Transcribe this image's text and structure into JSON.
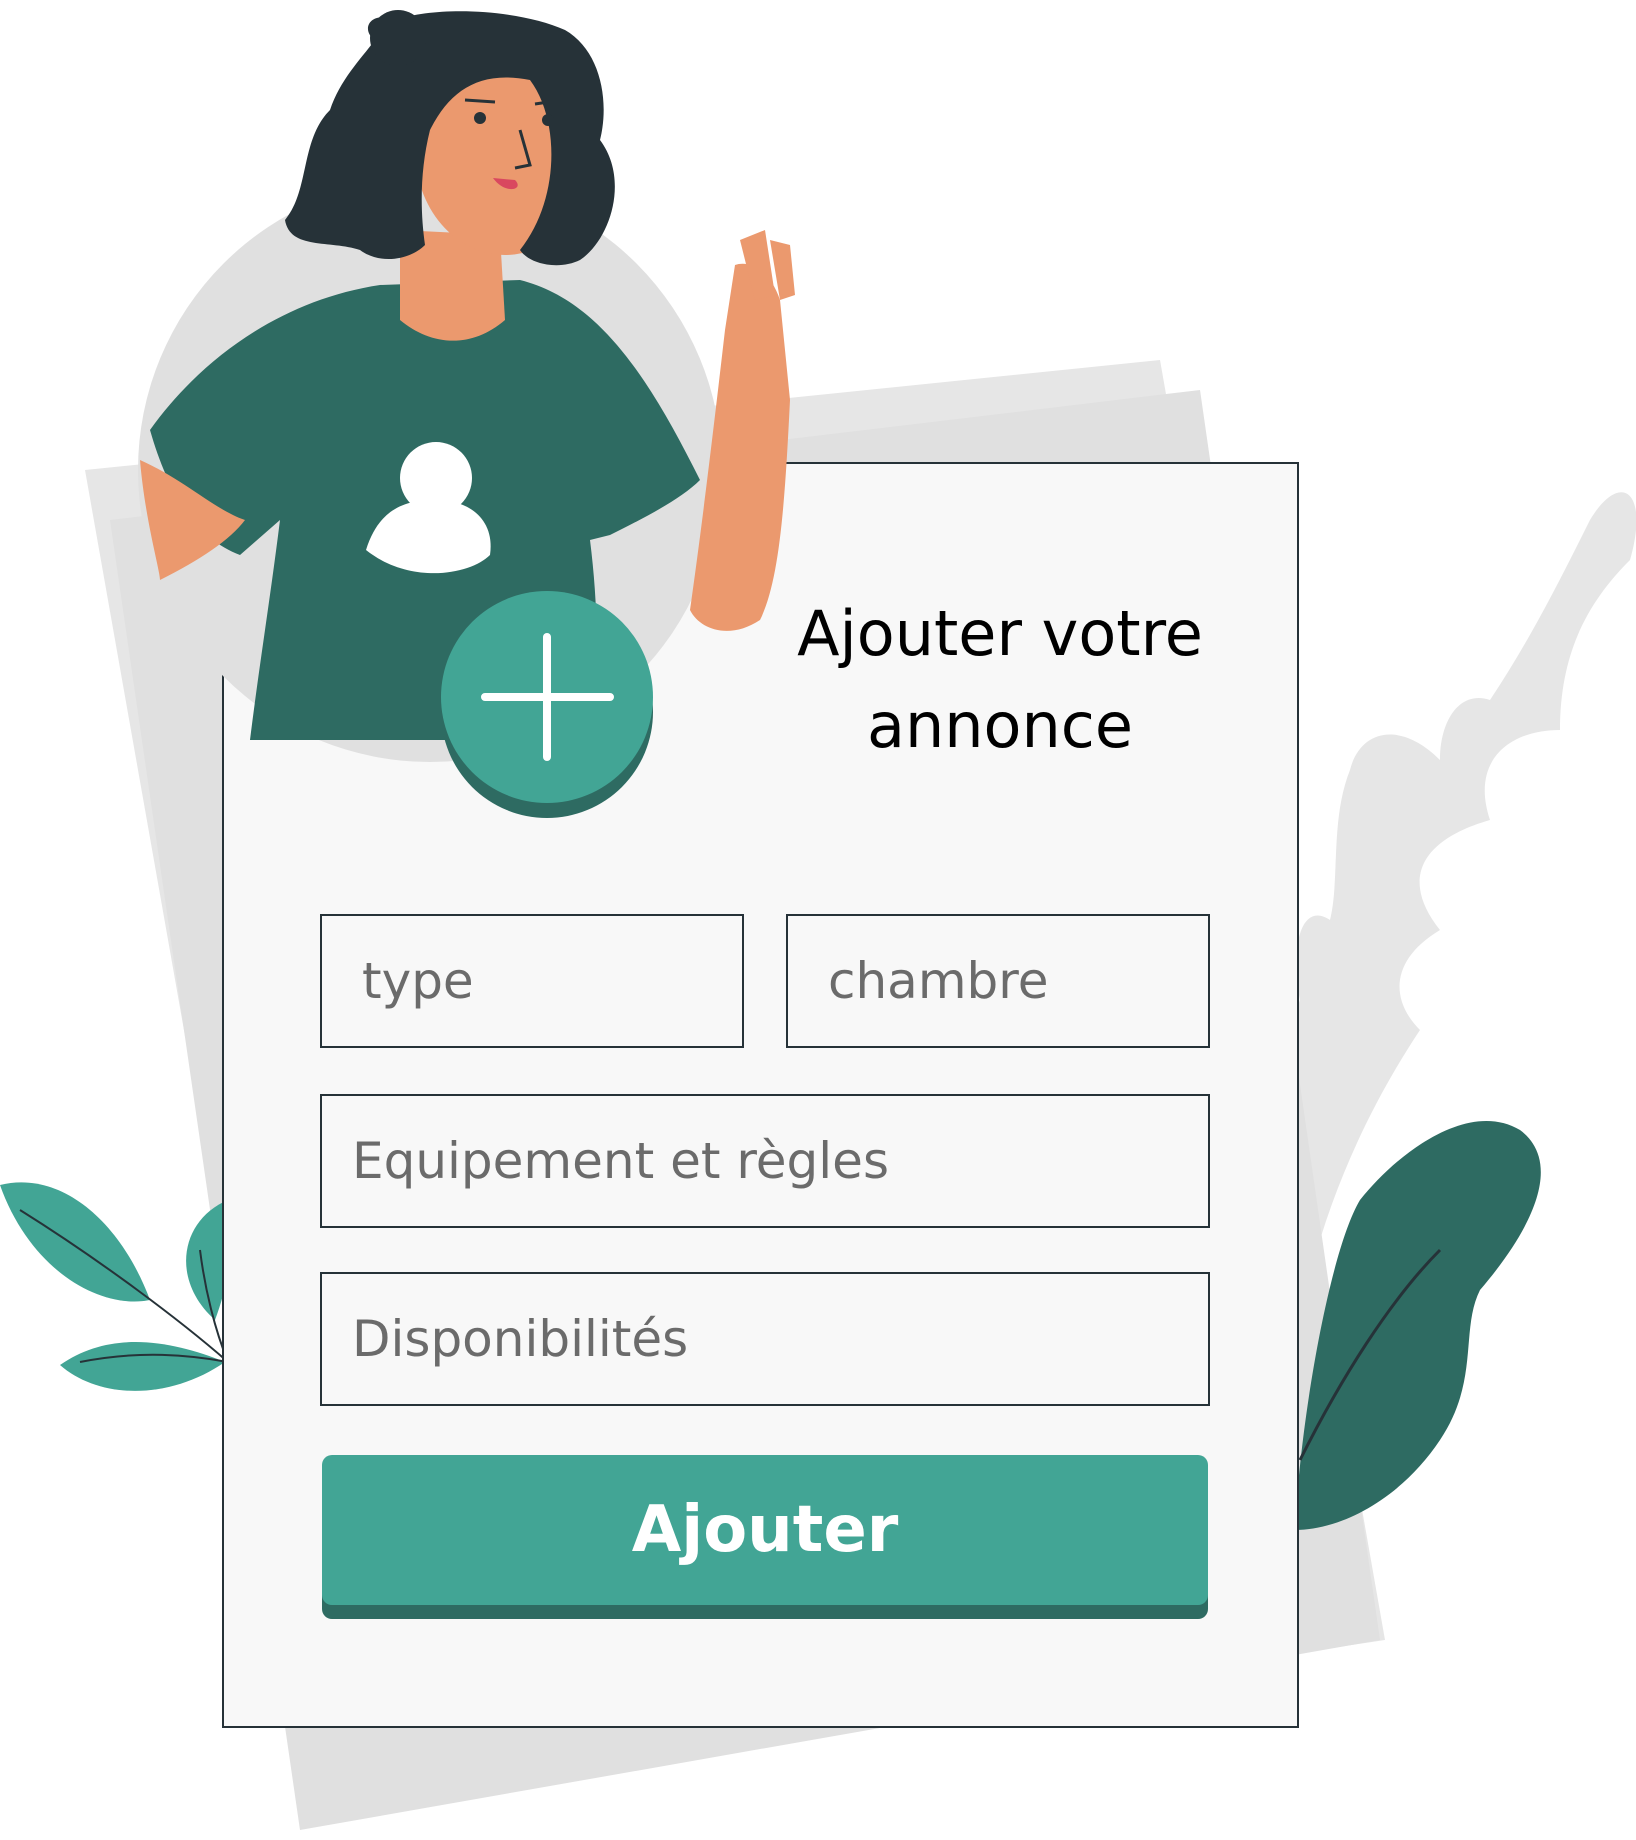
{
  "form": {
    "title_line1": "Ajouter votre",
    "title_line2": "annonce",
    "type_placeholder": "type",
    "chambre_placeholder": "chambre",
    "equipement_placeholder": "Equipement et règles",
    "disponibilites_placeholder": "Disponibilités",
    "submit_label": "Ajouter"
  },
  "colors": {
    "accent": "#42a595",
    "accent_dark": "#2e6b62",
    "background_shapes": "#e6e6e6",
    "card": "#f8f8f8",
    "skin": "#eb996e",
    "hair": "#263238"
  },
  "icons": {
    "add": "plus-icon",
    "user": "user-icon"
  }
}
